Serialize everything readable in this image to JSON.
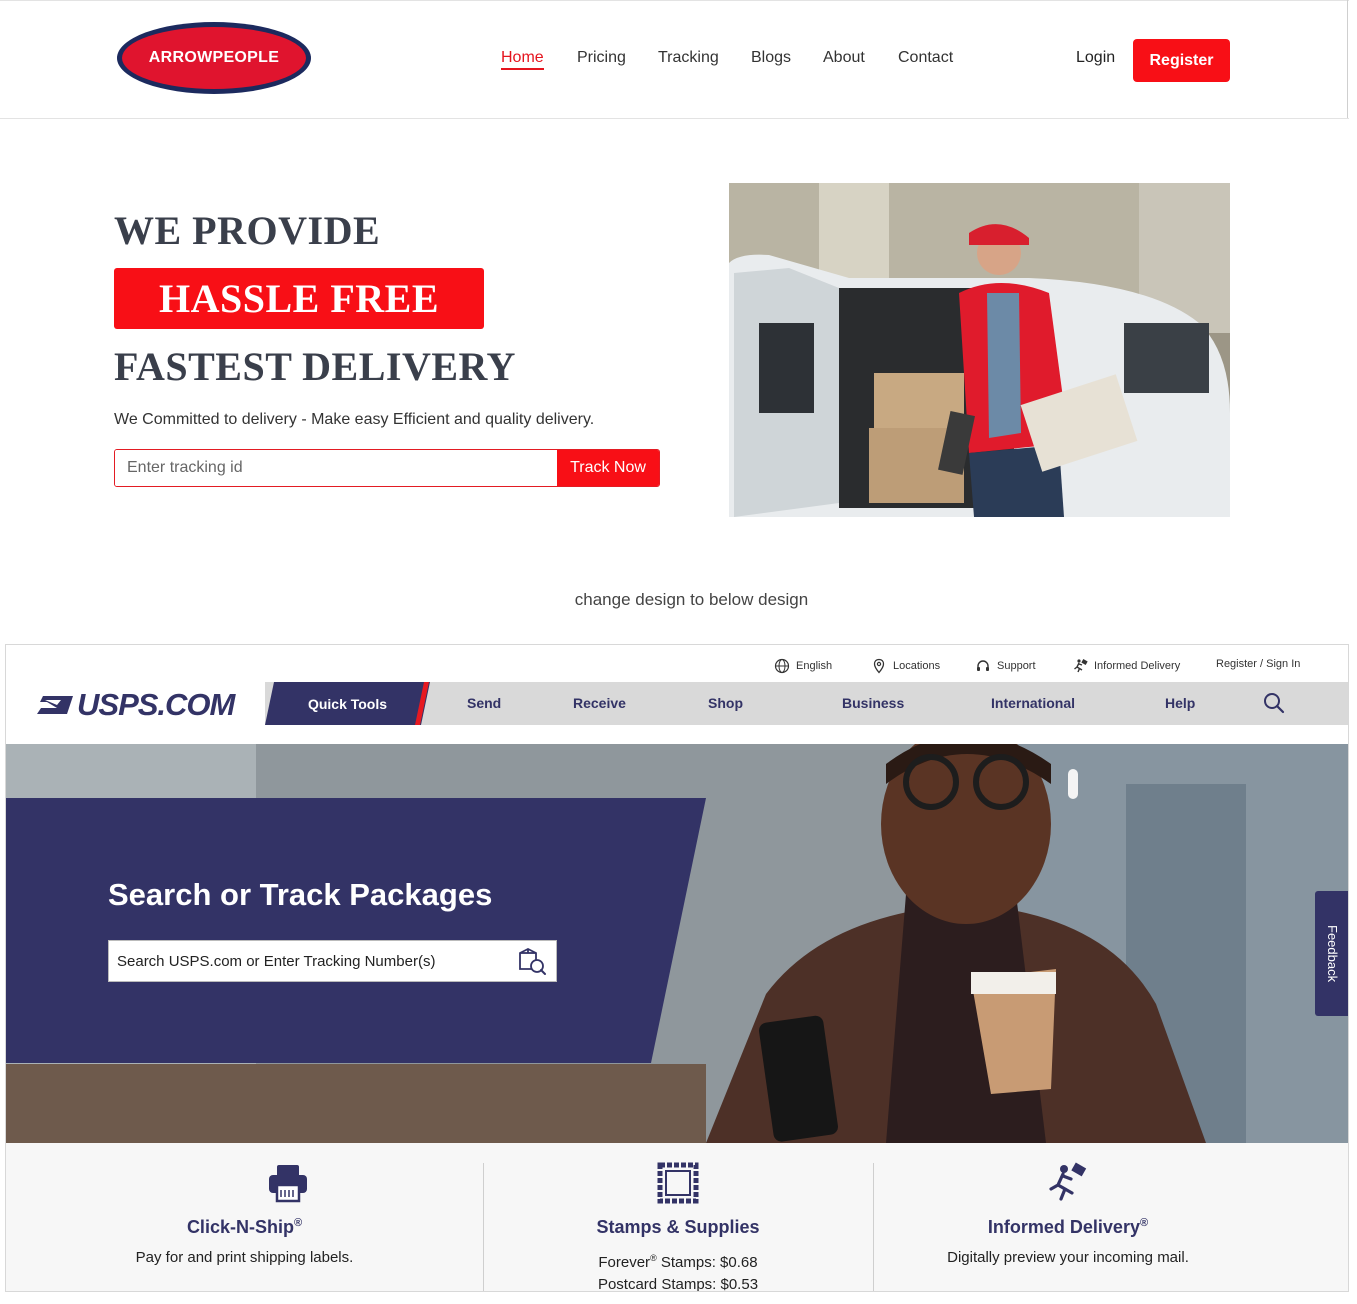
{
  "brand": {
    "logo_text": "ARROWPEOPLE"
  },
  "nav": {
    "items": [
      {
        "label": "Home",
        "active": true
      },
      {
        "label": "Pricing"
      },
      {
        "label": "Tracking"
      },
      {
        "label": "Blogs"
      },
      {
        "label": "About"
      },
      {
        "label": "Contact"
      }
    ],
    "login": "Login",
    "register": "Register"
  },
  "hero": {
    "line1": "WE PROVIDE",
    "badge": "HASSLE FREE",
    "line3": "FASTEST DELIVERY",
    "subtitle": "We Committed to delivery - Make easy Efficient and quality delivery.",
    "tracking_placeholder": "Enter tracking id",
    "track_button": "Track Now"
  },
  "note": "change design to below design",
  "usps": {
    "util": {
      "english": "English",
      "locations": "Locations",
      "support": "Support",
      "informed_delivery": "Informed Delivery",
      "register_signin": "Register / Sign In"
    },
    "logo": "USPS.COM",
    "nav": {
      "quick_tools": "Quick Tools",
      "items": [
        "Send",
        "Receive",
        "Shop",
        "Business",
        "International",
        "Help"
      ]
    },
    "hero": {
      "title": "Search or Track Packages",
      "search_placeholder": "Search USPS.com or Enter Tracking Number(s)"
    },
    "feedback": "Feedback",
    "cards": [
      {
        "title": "Click-N-Ship",
        "mark": "®",
        "desc": "Pay for and print shipping labels.",
        "icon": "printer-icon"
      },
      {
        "title": "Stamps & Supplies",
        "mark": "",
        "desc_line1_a": "Forever",
        "desc_line1_mark": "®",
        "desc_line1_b": " Stamps: $0.68",
        "desc_line2": "Postcard Stamps: $0.53",
        "icon": "stamp-icon"
      },
      {
        "title": "Informed Delivery",
        "mark": "®",
        "desc": "Digitally preview your incoming mail.",
        "icon": "running-mail-icon"
      }
    ],
    "colors": {
      "navy": "#333366",
      "red": "#e71921",
      "nav_gray": "#d9d9d9"
    }
  },
  "colors": {
    "brand_red": "#f80f16",
    "heading": "#3a3f4b"
  }
}
